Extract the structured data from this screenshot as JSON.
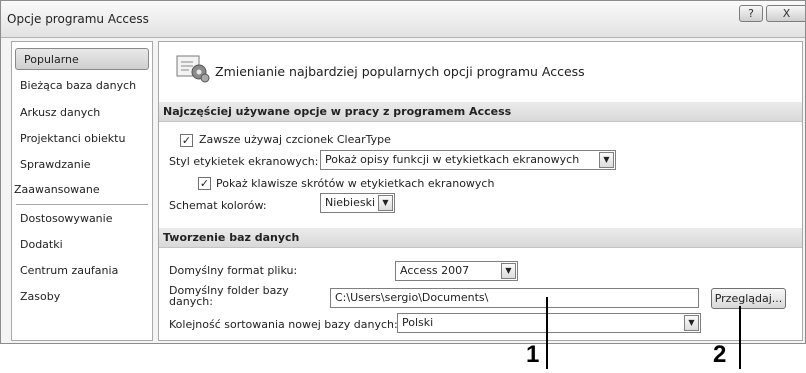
{
  "window": {
    "title": "Opcje programu Access",
    "help_label": "?",
    "close_label": "X"
  },
  "sidebar": {
    "items": [
      {
        "label": "Popularne",
        "active": true
      },
      {
        "label": "Bieżąca baza danych"
      },
      {
        "label": "Arkusz danych"
      },
      {
        "label": "Projektanci obiektu"
      },
      {
        "label": "Sprawdzanie"
      },
      {
        "label": "Zaawansowane"
      },
      {
        "label": "Dostosowywanie"
      },
      {
        "label": "Dodatki"
      },
      {
        "label": "Centrum zaufania"
      },
      {
        "label": "Zasoby"
      }
    ]
  },
  "header": {
    "title": "Zmienianie najbardziej popularnych opcji programu Access",
    "icon": "options-icon"
  },
  "section_common": {
    "title": "Najczęściej używane opcje w pracy z programem Access",
    "cleartype_label": "Zawsze używaj czcionek ClearType",
    "cleartype_checked": true,
    "screentip_style_label": "Styl etykietek ekranowych:",
    "screentip_style_value": "Pokaż opisy funkcji w etykietkach ekranowych",
    "shortcut_keys_label": "Pokaż klawisze skrótów w etykietkach ekranowych",
    "shortcut_keys_checked": true,
    "color_scheme_label": "Schemat kolorów:",
    "color_scheme_value": "Niebieski"
  },
  "section_create": {
    "title": "Tworzenie baz danych",
    "file_format_label": "Domyślny format pliku:",
    "file_format_value": "Access 2007",
    "folder_label_line1": "Domyślny folder bazy",
    "folder_label_line2": "danych:",
    "folder_value": "C:\\Users\\sergio\\Documents\\",
    "browse_label": "Przeglądaj...",
    "sort_order_label": "Kolejność sortowania nowej bazy danych:",
    "sort_order_value": "Polski"
  },
  "callouts": {
    "one": "1",
    "two": "2"
  },
  "dropdown_glyph": "▼",
  "check_glyph": "✓"
}
